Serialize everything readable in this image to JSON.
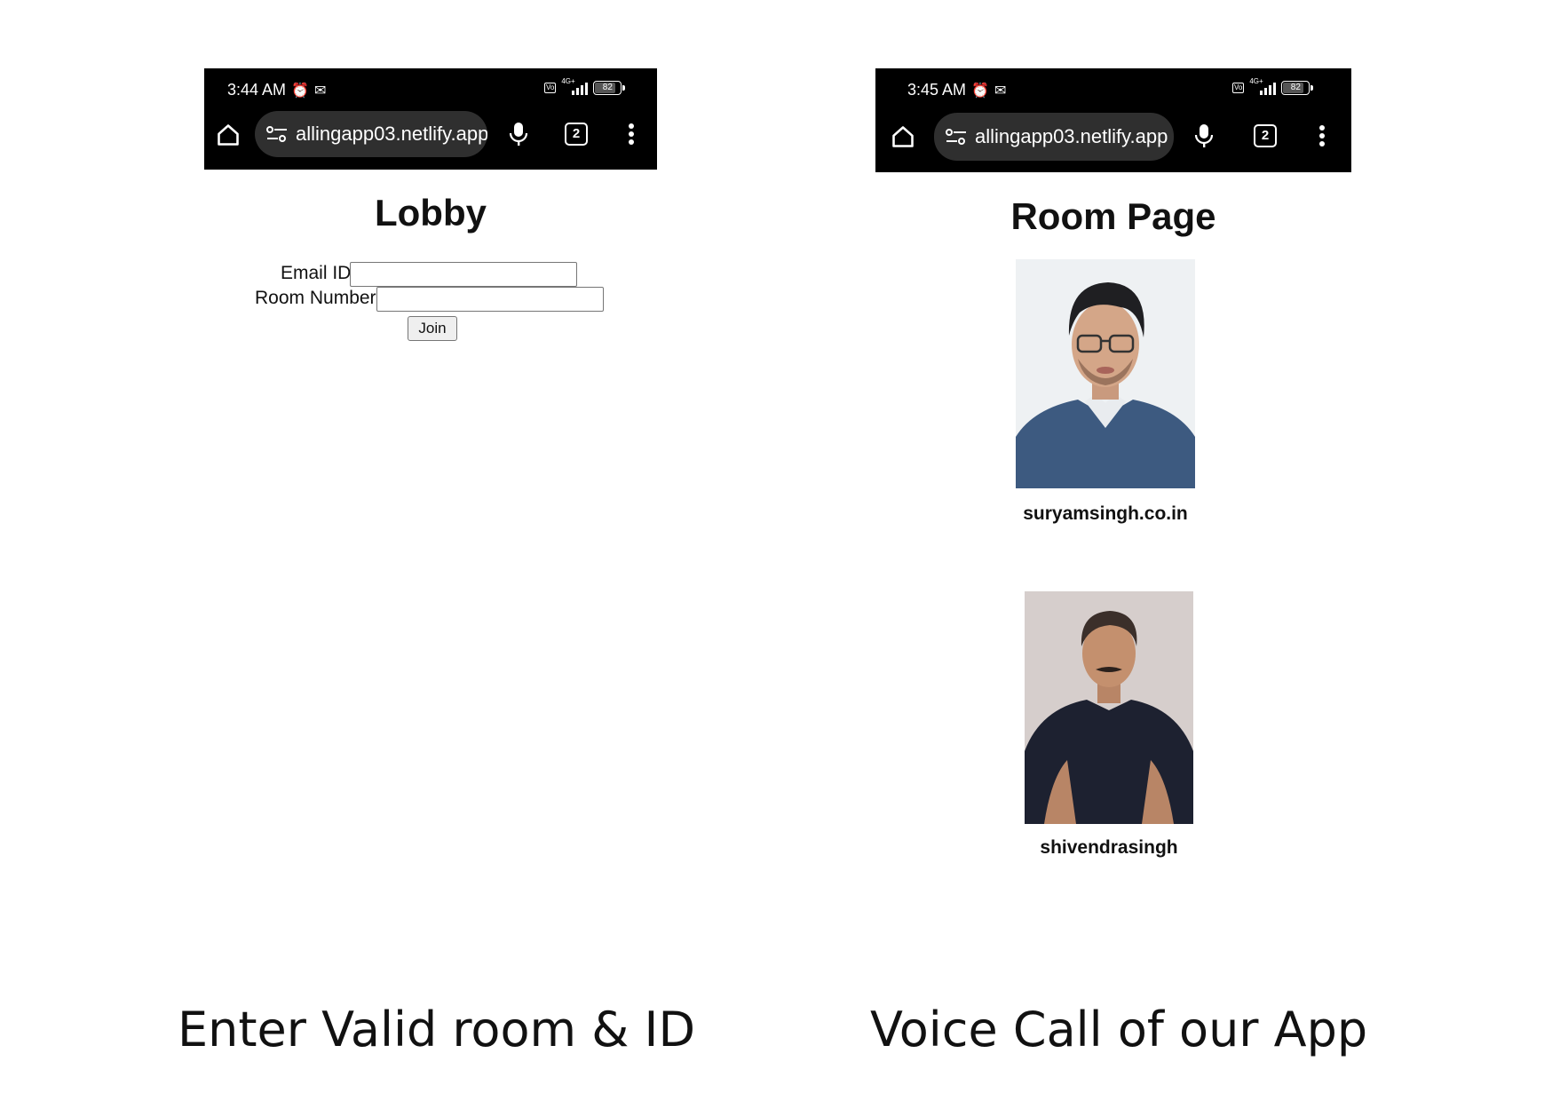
{
  "lobby_screen": {
    "status_bar": {
      "time": "3:44 AM",
      "status_icons": [
        "alarm-icon",
        "gmail-icon"
      ],
      "battery": "82",
      "battery_level": 0.82,
      "network": "4G+"
    },
    "browser": {
      "url": "allingapp03.netlify.app",
      "tab_count": "2"
    },
    "page": {
      "title": "Lobby",
      "email_label": "Email ID",
      "email_value": "",
      "room_label": "Room Number",
      "room_value": "",
      "join_label": "Join"
    }
  },
  "room_screen": {
    "status_bar": {
      "time": "3:45 AM",
      "status_icons": [
        "alarm-icon",
        "gmail-icon"
      ],
      "battery": "82",
      "battery_level": 0.82,
      "network": "4G+"
    },
    "browser": {
      "url": "allingapp03.netlify.app",
      "tab_count": "2"
    },
    "page": {
      "title": "Room Page",
      "participants": [
        {
          "name": "suryamsingh.co.in"
        },
        {
          "name": "shivendrasingh"
        }
      ]
    }
  },
  "captions": {
    "left": "Enter Valid room & ID",
    "right": "Voice Call of our App"
  },
  "colors": {
    "chrome_bar": "#000000",
    "url_pill": "#2f2f2f",
    "page_background": "#ffffff",
    "text": "#111111"
  }
}
